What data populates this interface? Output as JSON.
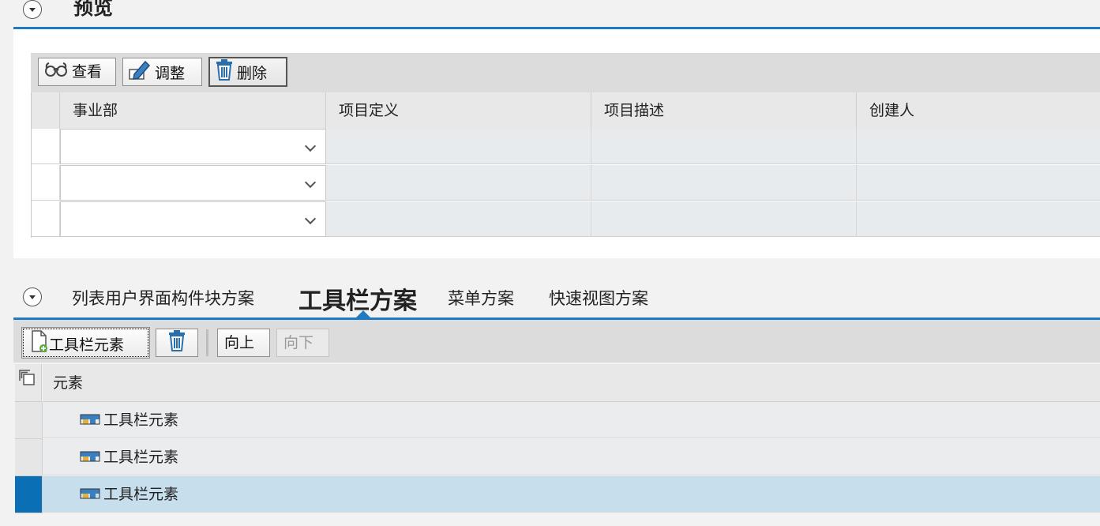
{
  "preview": {
    "title": "预览",
    "toolbar": {
      "view_label": "查看",
      "adjust_label": "调整",
      "delete_label": "删除"
    },
    "columns": [
      "事业部",
      "项目定义",
      "项目描述",
      "创建人"
    ],
    "rows": [
      {
        "business_unit": "",
        "project_def": "",
        "project_desc": "",
        "creator": ""
      },
      {
        "business_unit": "",
        "project_def": "",
        "project_desc": "",
        "creator": ""
      },
      {
        "business_unit": "",
        "project_def": "",
        "project_desc": "",
        "creator": ""
      }
    ]
  },
  "schemes": {
    "tabs": [
      {
        "label": "列表用户界面构件块方案",
        "active": false
      },
      {
        "label": "工具栏方案",
        "active": true
      },
      {
        "label": "菜单方案",
        "active": false
      },
      {
        "label": "快速视图方案",
        "active": false
      }
    ],
    "toolbar": {
      "add_element_label": "工具栏元素",
      "move_up_label": "向上",
      "move_down_label": "向下",
      "move_down_disabled": true
    },
    "table": {
      "column_header": "元素",
      "rows": [
        {
          "label": "工具栏元素",
          "selected": false
        },
        {
          "label": "工具栏元素",
          "selected": false
        },
        {
          "label": "工具栏元素",
          "selected": true
        }
      ]
    }
  },
  "colors": {
    "accent_blue": "#1f7ac2",
    "selected_row_marker": "#0a6fb5",
    "selected_row_bg": "#c7dfec",
    "toolbar_bg": "#dcdcdc"
  }
}
